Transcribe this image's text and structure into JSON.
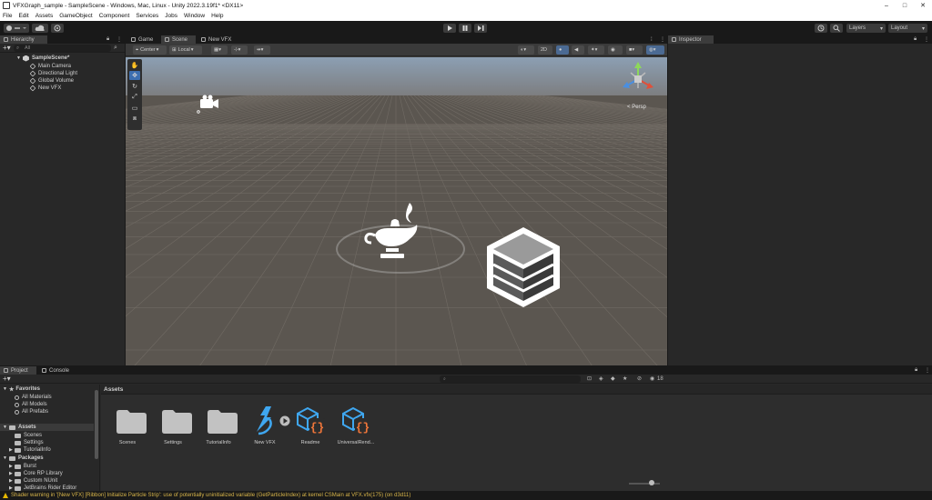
{
  "window": {
    "title": "VFXGraph_sample - SampleScene - Windows, Mac, Linux - Unity 2022.3.19f1* <DX11>",
    "controls": [
      "–",
      "□",
      "✕"
    ]
  },
  "menu": [
    "File",
    "Edit",
    "Assets",
    "GameObject",
    "Component",
    "Services",
    "Jobs",
    "Window",
    "Help"
  ],
  "toolbar": {
    "layers_label": "Layers",
    "layout_label": "Layout"
  },
  "hierarchy": {
    "tab_label": "Hierarchy",
    "search_placeholder": "All",
    "scene_name": "SampleScene*",
    "items": [
      "Main Camera",
      "Directional Light",
      "Global Volume",
      "New VFX"
    ]
  },
  "scene_tabs": [
    "Game",
    "Scene",
    "New VFX"
  ],
  "scene_toolbar": {
    "pivot": "Center",
    "space": "Local",
    "mode_2d": "2D"
  },
  "scene_view": {
    "projection": "Persp",
    "gizmo_axes": [
      "y",
      "x",
      "z"
    ]
  },
  "inspector": {
    "tab_label": "Inspector"
  },
  "project": {
    "tabs": [
      "Project",
      "Console"
    ],
    "count_badge": "18",
    "header": "Assets",
    "tree": {
      "favorites_label": "Favorites",
      "favorites": [
        "All Materials",
        "All Models",
        "All Prefabs"
      ],
      "assets_label": "Assets",
      "assets": [
        "Scenes",
        "Settings",
        "TutorialInfo"
      ],
      "packages_label": "Packages",
      "packages": [
        "Burst",
        "Core RP Library",
        "Custom NUnit",
        "JetBrains Rider Editor"
      ]
    },
    "assets": [
      {
        "name": "Scenes",
        "type": "folder"
      },
      {
        "name": "Settings",
        "type": "folder"
      },
      {
        "name": "TutorialInfo",
        "type": "folder"
      },
      {
        "name": "New VFX",
        "type": "vfx"
      },
      {
        "name": "Readme",
        "type": "script"
      },
      {
        "name": "UniversalRend...",
        "type": "script"
      }
    ]
  },
  "status": {
    "message": "Shader warning in '[New VFX] [Ribbon] Initialize Particle Strip': use of potentially uninitialized variable (GetParticleIndex) at kernel CSMain at VFX.vfx(175) (on d3d11)"
  },
  "colors": {
    "accent": "#3d7bd9",
    "vfx_blue": "#3fa7f0",
    "script_orange": "#f0763a",
    "warning": "#e6b800"
  }
}
